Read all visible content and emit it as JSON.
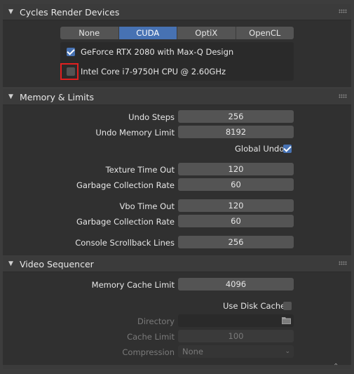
{
  "cycles": {
    "title": "Cycles Render Devices",
    "tabs": [
      "None",
      "CUDA",
      "OptiX",
      "OpenCL"
    ],
    "active_tab": "CUDA",
    "devices": [
      {
        "label": "GeForce RTX 2080 with Max-Q Design",
        "checked": true
      },
      {
        "label": "Intel Core i7-9750H CPU @ 2.60GHz",
        "checked": false
      }
    ]
  },
  "memory": {
    "title": "Memory & Limits",
    "undo_steps_label": "Undo Steps",
    "undo_steps_value": "256",
    "undo_memory_label": "Undo Memory Limit",
    "undo_memory_value": "8192",
    "global_undo_label": "Global Undo",
    "global_undo_checked": true,
    "texture_timeout_label": "Texture Time Out",
    "texture_timeout_value": "120",
    "gc_rate_label_1": "Garbage Collection Rate",
    "gc_rate_value_1": "60",
    "vbo_timeout_label": "Vbo Time Out",
    "vbo_timeout_value": "120",
    "gc_rate_label_2": "Garbage Collection Rate",
    "gc_rate_value_2": "60",
    "console_label": "Console Scrollback Lines",
    "console_value": "256"
  },
  "sequencer": {
    "title": "Video Sequencer",
    "cache_limit_label": "Memory Cache Limit",
    "cache_limit_value": "4096",
    "use_disk_cache_label": "Use Disk Cache",
    "use_disk_cache_checked": false,
    "directory_label": "Directory",
    "disk_cache_limit_label": "Cache Limit",
    "disk_cache_limit_value": "100",
    "compression_label": "Compression",
    "compression_value": "None"
  },
  "colors": {
    "accent": "#4772b3",
    "highlight": "#e02020"
  }
}
